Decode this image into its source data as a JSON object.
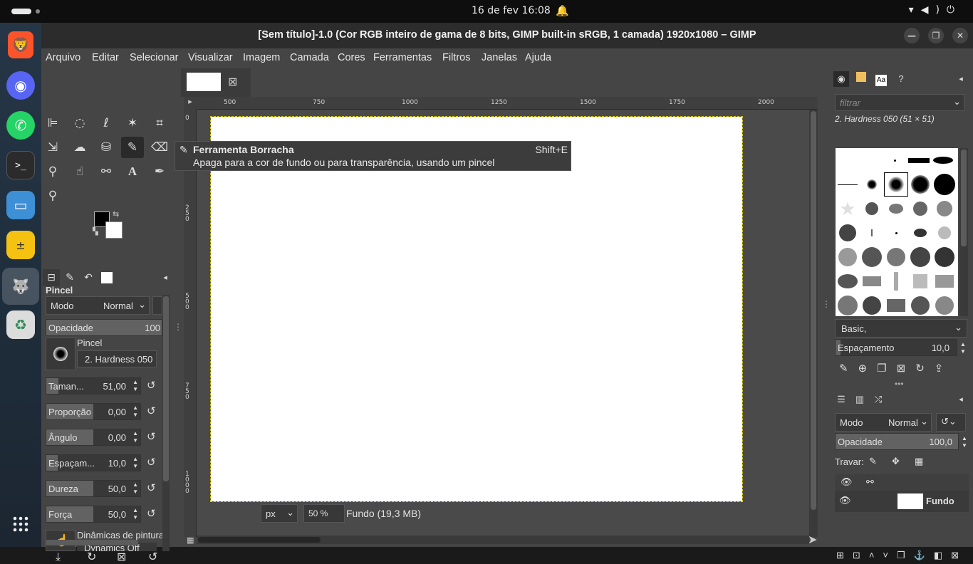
{
  "topbar": {
    "clock": "16 de fev  16:08",
    "tray_icons": [
      "wifi-icon",
      "volume-icon",
      "power-icon"
    ]
  },
  "dock": {
    "apps": [
      "brave-browser",
      "discord",
      "whatsapp",
      "terminal",
      "files",
      "calculator",
      "gimp",
      "trash"
    ]
  },
  "window": {
    "title": "[Sem título]-1.0 (Cor RGB inteiro de gama de 8 bits, GIMP built-in sRGB, 1 camada) 1920x1080 – GIMP"
  },
  "menubar": {
    "items": [
      "Arquivo",
      "Editar",
      "Selecionar",
      "Visualizar",
      "Imagem",
      "Camada",
      "Cores",
      "Ferramentas",
      "Filtros",
      "Janelas",
      "Ajuda"
    ]
  },
  "tool_options": {
    "title": "Pincel",
    "mode_label": "Modo",
    "mode_value": "Normal",
    "opacity_label": "Opacidade",
    "opacity_value": "100",
    "brush_label": "Pincel",
    "brush_value": "2. Hardness 050",
    "size_label": "Taman...",
    "size_value": "51,00",
    "ratio_label": "Proporção",
    "ratio_value": "0,00",
    "angle_label": "Ângulo",
    "angle_value": "0,00",
    "spacing_label": "Espaçam...",
    "spacing_value": "10,0",
    "hardness_label": "Dureza",
    "hardness_value": "50,0",
    "force_label": "Força",
    "force_value": "50,0",
    "dynamics_label": "Dinâmicas de pintura",
    "dynamics_value": "Dynamics Off"
  },
  "ruler": {
    "h_labels": [
      "500",
      "750",
      "1000",
      "1250",
      "1500",
      "1750",
      "2000"
    ],
    "v_labels": [
      "0",
      "250",
      "500",
      "750",
      "1000"
    ]
  },
  "tooltip": {
    "name": "Ferramenta Borracha",
    "shortcut": "Shift+E",
    "description": "Apaga para a cor de fundo ou para transparência, usando um pincel"
  },
  "statusbar": {
    "unit": "px",
    "zoom": "50 %",
    "layer_info": "Fundo (19,3 MB)"
  },
  "brushes": {
    "filter_placeholder": "filtrar",
    "selected_name": "2. Hardness 050 (51 × 51)",
    "tag": "Basic,",
    "spacing_label": "Espaçamento",
    "spacing_value": "10,0"
  },
  "layers": {
    "mode_label": "Modo",
    "mode_value": "Normal",
    "opacity_label": "Opacidade",
    "opacity_value": "100,0",
    "lock_label": "Travar:",
    "layer_name": "Fundo"
  }
}
